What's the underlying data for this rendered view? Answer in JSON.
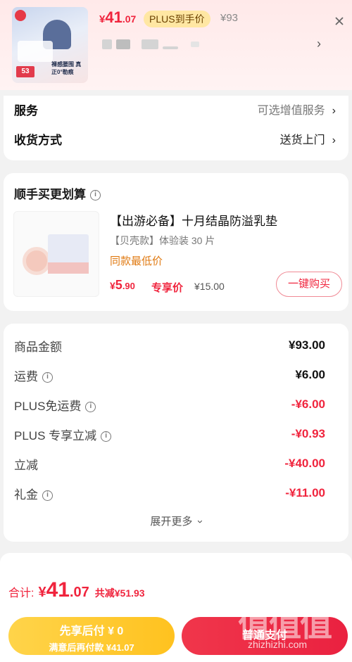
{
  "header": {
    "price": {
      "yen": "¥",
      "int": "41",
      "dec": ".07"
    },
    "plus_tag": "PLUS到手价",
    "original_price": "¥93",
    "thumb": {
      "badge": "53",
      "tagline": "裸感腰围 真正0°勒痕"
    }
  },
  "options": [
    {
      "label": "服务",
      "value": "可选增值服务"
    },
    {
      "label": "收货方式",
      "value": "送货上门"
    }
  ],
  "bundle": {
    "title": "顺手买更划算",
    "product_name": "【出游必备】十月结晶防溢乳垫",
    "spec": "【贝壳款】体验装 30 片",
    "low_price_note": "同款最低价",
    "price": {
      "yen": "¥",
      "int": "5",
      "dec": ".90"
    },
    "plus_label": "专享价",
    "original_price": "¥15.00",
    "buy_button": "一键购买"
  },
  "fees": [
    {
      "label": "商品金额",
      "amount": "¥93.00",
      "info": false,
      "red": false
    },
    {
      "label": "运费",
      "amount": "¥6.00",
      "info": true,
      "red": false
    },
    {
      "label": "PLUS免运费",
      "amount": "-¥6.00",
      "info": true,
      "red": true
    },
    {
      "label": "PLUS 专享立减",
      "amount": "-¥0.93",
      "info": true,
      "red": true
    },
    {
      "label": "立减",
      "amount": "-¥40.00",
      "info": false,
      "red": true
    },
    {
      "label": "礼金",
      "amount": "-¥11.00",
      "info": true,
      "red": true
    }
  ],
  "expand_label": "展开更多",
  "footer": {
    "total_label": "合计:",
    "total": {
      "yen": "¥",
      "int": "41",
      "dec": ".07"
    },
    "reduced": "共减¥51.93",
    "pay_later": {
      "line1": "先享后付 ¥ 0",
      "line2": "满意后再付款 ¥41.07"
    },
    "pay_now": "普通支付"
  },
  "watermark": {
    "big": "值值值",
    "small": "zhizhizhi.com"
  },
  "colors": {
    "accent_red": "#f0243d",
    "plus_gold": "#ffe7a3",
    "pay_later_yellow": "#ffc21f"
  }
}
